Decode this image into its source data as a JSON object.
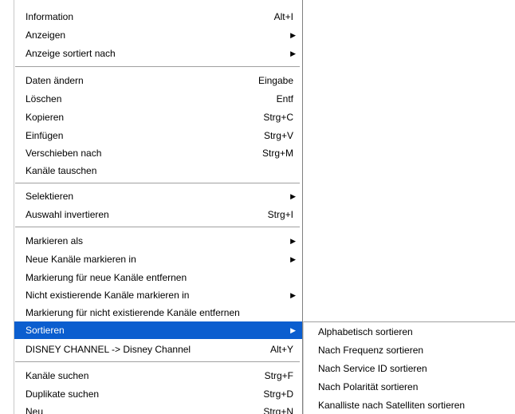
{
  "menu": {
    "items": [
      {
        "label": "Information",
        "shortcut": "Alt+I"
      },
      {
        "label": "Anzeigen",
        "arrow": "▶"
      },
      {
        "label": "Anzeige sortiert nach",
        "arrow": "▶"
      },
      {
        "label": "Daten ändern",
        "shortcut": "Eingabe"
      },
      {
        "label": "Löschen",
        "shortcut": "Entf"
      },
      {
        "label": "Kopieren",
        "shortcut": "Strg+C"
      },
      {
        "label": "Einfügen",
        "shortcut": "Strg+V"
      },
      {
        "label": "Verschieben nach",
        "shortcut": "Strg+M"
      },
      {
        "label": "Kanäle tauschen"
      },
      {
        "label": "Selektieren",
        "arrow": "▶"
      },
      {
        "label": "Auswahl invertieren",
        "shortcut": "Strg+I"
      },
      {
        "label": "Markieren als",
        "arrow": "▶"
      },
      {
        "label": "Neue Kanäle markieren in",
        "arrow": "▶"
      },
      {
        "label": "Markierung für neue Kanäle entfernen"
      },
      {
        "label": "Nicht existierende Kanäle markieren in",
        "arrow": "▶"
      },
      {
        "label": "Markierung für nicht existierende Kanäle entfernen"
      },
      {
        "label": "Sortieren",
        "arrow": "▶"
      },
      {
        "label": "DISNEY CHANNEL -> Disney Channel",
        "shortcut": "Alt+Y"
      },
      {
        "label": "Kanäle suchen",
        "shortcut": "Strg+F"
      },
      {
        "label": "Duplikate suchen",
        "shortcut": "Strg+D"
      },
      {
        "label": "Neu",
        "shortcut": "Strg+N"
      }
    ]
  },
  "submenu": {
    "items": [
      {
        "label": "Alphabetisch sortieren"
      },
      {
        "label": "Nach Frequenz sortieren"
      },
      {
        "label": "Nach Service ID sortieren"
      },
      {
        "label": "Nach Polarität sortieren"
      },
      {
        "label": "Kanalliste nach Satelliten sortieren"
      }
    ]
  },
  "colors": {
    "highlight": "#0b5ecf",
    "highlight_text": "#ffffff"
  }
}
